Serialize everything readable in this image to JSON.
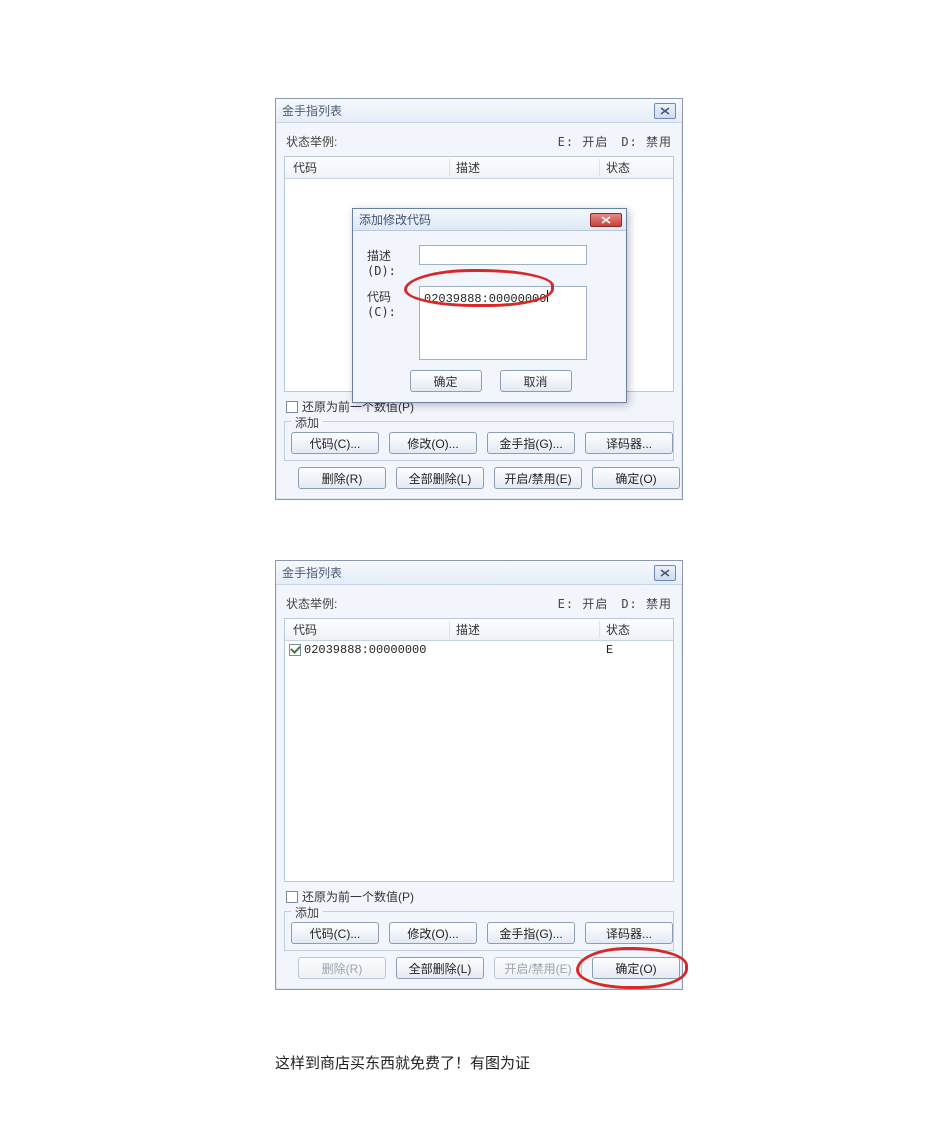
{
  "window1": {
    "title": "金手指列表",
    "status_label": "状态举例:",
    "status_right": "E: 开启　D: 禁用",
    "columns": {
      "code": "代码",
      "desc": "描述",
      "stat": "状态"
    },
    "restore_checkbox": "还原为前一个数值(P)",
    "add_legend": "添加",
    "buttons_row1": {
      "code": "代码(C)...",
      "modify": "修改(O)...",
      "cheat": "金手指(G)...",
      "decoder": "译码器..."
    },
    "buttons_row2": {
      "delete": "删除(R)",
      "delete_all": "全部删除(L)",
      "toggle": "开启/禁用(E)",
      "ok": "确定(O)"
    }
  },
  "modal": {
    "title": "添加修改代码",
    "label_desc": "描述(D):",
    "label_code": "代码(C):",
    "desc_value": "",
    "code_value": "02039888:00000000",
    "ok": "确定",
    "cancel": "取消"
  },
  "window2": {
    "title": "金手指列表",
    "status_label": "状态举例:",
    "status_right": "E: 开启　D: 禁用",
    "columns": {
      "code": "代码",
      "desc": "描述",
      "stat": "状态"
    },
    "rows": [
      {
        "code": "02039888:00000000",
        "desc": "",
        "stat": "E",
        "checked": true
      }
    ],
    "restore_checkbox": "还原为前一个数值(P)",
    "add_legend": "添加",
    "buttons_row1": {
      "code": "代码(C)...",
      "modify": "修改(O)...",
      "cheat": "金手指(G)...",
      "decoder": "译码器..."
    },
    "buttons_row2": {
      "delete": "删除(R)",
      "delete_all": "全部删除(L)",
      "toggle": "开启/禁用(E)",
      "ok": "确定(O)"
    }
  },
  "caption": "这样到商店买东西就免费了！有图为证"
}
